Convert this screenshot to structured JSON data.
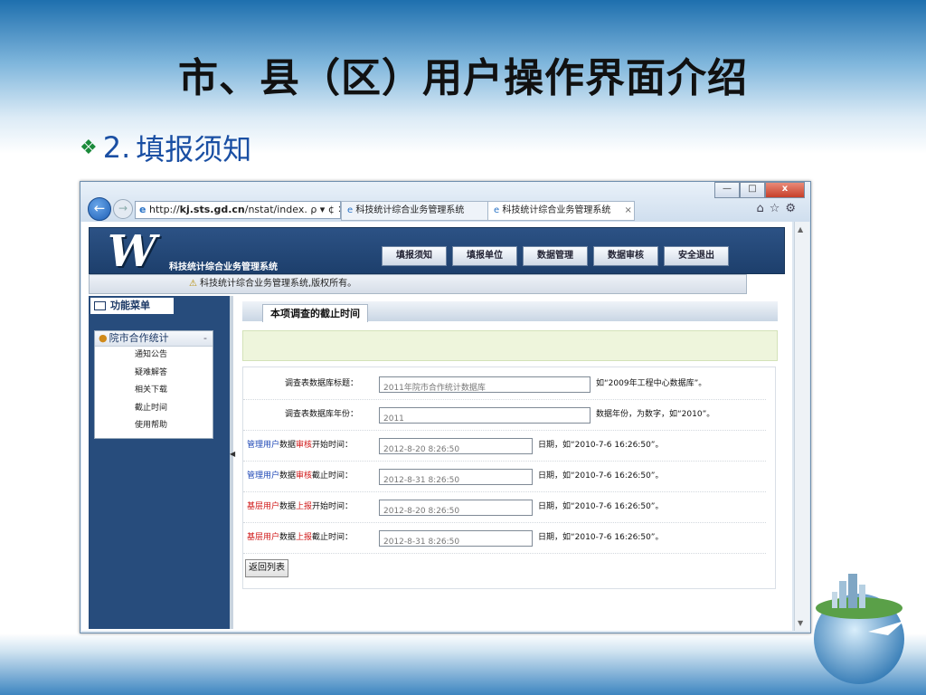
{
  "slide": {
    "title": "市、县（区）用户操作界面介绍",
    "subtitle_num": "2.",
    "subtitle_text": "填报须知"
  },
  "browser": {
    "window_controls": [
      "—",
      "□",
      "x"
    ],
    "address_prefix": "http://",
    "address_domain": "kj.sts.gd.cn",
    "address_path": "/nstat/index.",
    "address_actions": "ρ ▾ ¢ ✕",
    "tabs": [
      {
        "label": "科技统计综合业务管理系统"
      },
      {
        "label": "科技统计综合业务管理系统",
        "close": "×"
      }
    ],
    "toolbar_icons": [
      "home-icon",
      "star-icon",
      "gear-icon"
    ],
    "toolbar_glyphs": "⌂☆⚙"
  },
  "app": {
    "logo_text": "W",
    "system_name": "科技统计综合业务管理系统",
    "menu": [
      "填报须知",
      "填报单位",
      "数据管理",
      "数据审核",
      "安全退出"
    ],
    "notice": "科技统计综合业务管理系统,版权所有。"
  },
  "sidebar": {
    "tab_label": "功能菜单",
    "group": "院市合作统计",
    "collapse": "-",
    "items": [
      "通知公告",
      "疑难解答",
      "相关下载",
      "截止时间",
      "使用帮助"
    ]
  },
  "main": {
    "section_title": "本项调查的截止时间",
    "fields": [
      {
        "label": "调查表数据库标题：",
        "value": "2011年院市合作统计数据库",
        "hint": "如“2009年工程中心数据库”。"
      },
      {
        "label": "调查表数据库年份：",
        "value": "2011",
        "hint": "数据年份，为数字，如“2010”。"
      },
      {
        "label_a": "管理用户",
        "label_b": "数据",
        "label_c": "审核",
        "label_d": "开始时间：",
        "value": "2012-8-20 8:26:50",
        "hint": "日期，如“2010-7-6 16:26:50”。"
      },
      {
        "label_a": "管理用户",
        "label_b": "数据",
        "label_c": "审核",
        "label_d": "截止时间：",
        "value": "2012-8-31 8:26:50",
        "hint": "日期，如“2010-7-6 16:26:50”。"
      },
      {
        "label_a": "基层用户",
        "label_b": "数据",
        "label_c": "上报",
        "label_d": "开始时间：",
        "value": "2012-8-20 8:26:50",
        "hint": "日期，如“2010-7-6 16:26:50”。"
      },
      {
        "label_a": "基层用户",
        "label_b": "数据",
        "label_c": "上报",
        "label_d": "截止时间：",
        "value": "2012-8-31 8:26:50",
        "hint": "日期，如“2010-7-6 16:26:50”。"
      }
    ],
    "back_button": "返回列表"
  },
  "colors": {
    "app_header": "#2c5285",
    "sidebar": "#274c7c",
    "subtitle": "#1a4fa3",
    "highlight_red": "#d01818",
    "highlight_blue": "#1c46b5"
  }
}
